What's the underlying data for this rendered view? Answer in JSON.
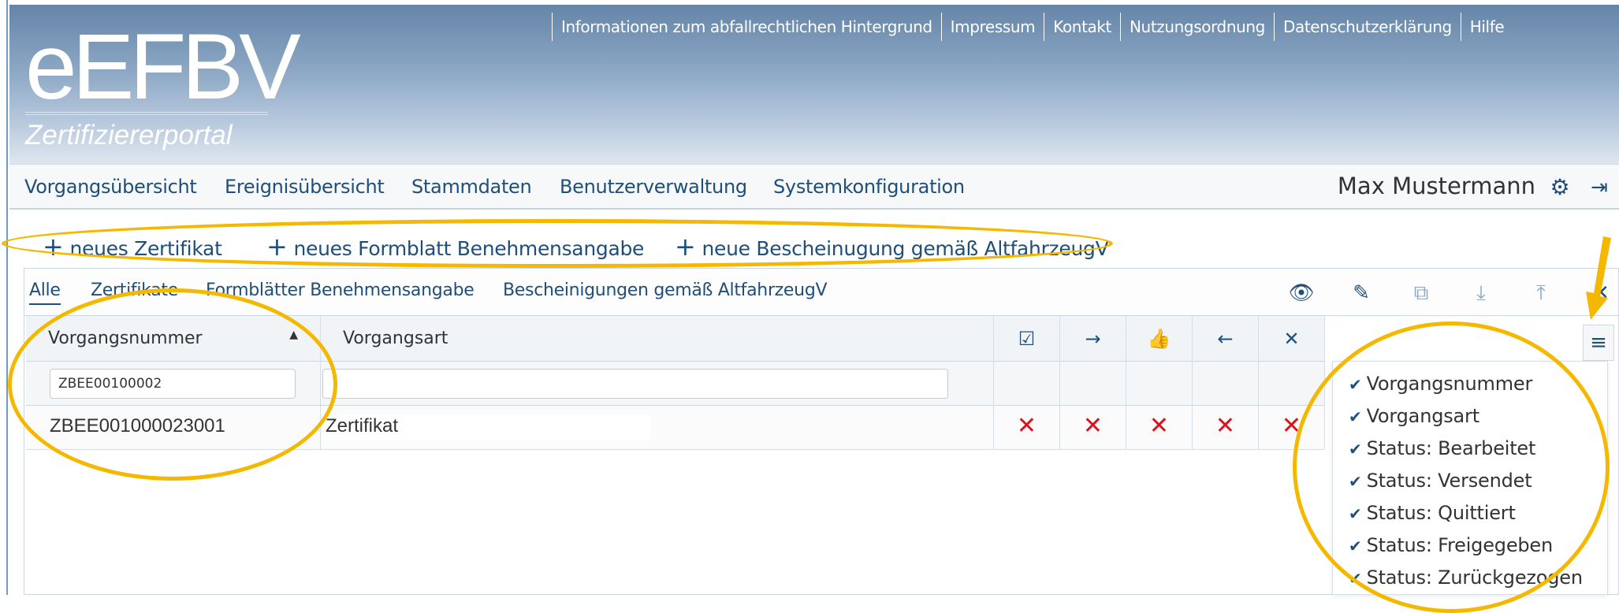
{
  "header": {
    "logo": "eEFBV",
    "subtitle": "Zertifiziererportal",
    "links": [
      "Informationen zum abfallrechtlichen Hintergrund",
      "Impressum",
      "Kontakt",
      "Nutzungsordnung",
      "Datenschutzerklärung",
      "Hilfe"
    ]
  },
  "nav": {
    "items": [
      "Vorgangsübersicht",
      "Ereignisübersicht",
      "Stammdaten",
      "Benutzerverwaltung",
      "Systemkonfiguration"
    ],
    "user": "Max Mustermann",
    "settings_icon": "gear-icon",
    "logout_icon": "logout-icon"
  },
  "create": {
    "items": [
      "neues Zertifikat",
      "neues Formblatt Benehmensangabe",
      "neue Bescheinugung gemäß AltfahrzeugV"
    ]
  },
  "tabs": {
    "items": [
      "Alle",
      "Zertifikate",
      "Formblätter Benehmensangabe",
      "Bescheinigungen gemäß AltfahrzeugV"
    ],
    "active": "Alle",
    "tools": [
      "eye-icon",
      "pencil-icon",
      "copy-icon",
      "download-icon",
      "upload-icon",
      "close-icon"
    ]
  },
  "table": {
    "columns": {
      "vorgangsnummer": "Vorgangsnummer",
      "vorgangsart": "Vorgangsart",
      "status_icons": [
        "clipboard-check-icon",
        "arrow-right-icon",
        "thumbs-up-icon",
        "arrow-left-icon",
        "close-icon"
      ]
    },
    "filter": {
      "vorgangsnummer": "ZBEE00100002",
      "vorgangsart": ""
    },
    "rows": [
      {
        "vorgangsnummer": "ZBEE001000023001",
        "vorgangsart": "Zertifikat",
        "status": [
          "✕",
          "✕",
          "✕",
          "✕",
          "✕"
        ]
      }
    ]
  },
  "column_menu": {
    "items": [
      "Vorgangsnummer",
      "Vorgangsart",
      "Status: Bearbeitet",
      "Status: Versendet",
      "Status: Quittiert",
      "Status: Freigegeben",
      "Status: Zurückgezogen"
    ]
  },
  "colors": {
    "accent": "#1f4e79",
    "error": "#e0101a",
    "annotation": "#f5b800"
  }
}
